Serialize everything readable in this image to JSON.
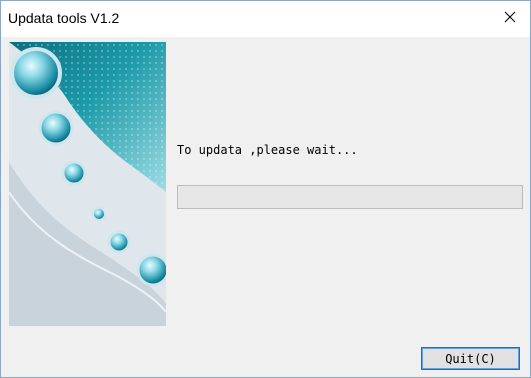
{
  "window": {
    "title": "Updata tools V1.2"
  },
  "titlebar": {
    "close_icon": "close-icon"
  },
  "banner": {
    "icon": "glass-orbs-illustration",
    "colors": {
      "teal_dark": "#0f7d8c",
      "teal_light": "#7fd3dc",
      "silver": "#dfe6ec"
    }
  },
  "status": {
    "message": "To updata ,please wait..."
  },
  "progress": {
    "value": 0
  },
  "buttons": {
    "quit_label": "Quit(C)"
  },
  "colors": {
    "window_border": "#8aa6c8",
    "client_background": "#f0f0f0",
    "focus_border": "#0078d7",
    "progress_track": "#e6e6e6"
  }
}
